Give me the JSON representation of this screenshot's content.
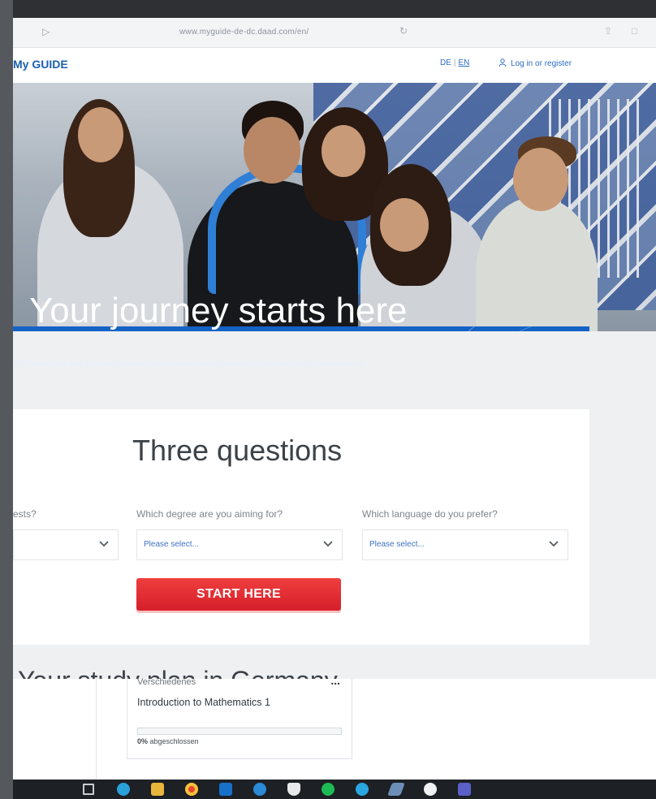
{
  "browser": {
    "url": "www.myguide-de-dc.daad.com/en/"
  },
  "header": {
    "logo": "My GUIDE",
    "lang_de": "DE",
    "lang_sep": "|",
    "lang_en": "EN",
    "login": "Log in or register"
  },
  "hero": {
    "title": "Your journey starts here",
    "subtitle": "IDE helps you find your way through the richness and diversity of German study programmes"
  },
  "questions": {
    "heading": "Three questions",
    "items": [
      {
        "label": "ests?",
        "value": ""
      },
      {
        "label": "Which degree are you aiming for?",
        "value": "Please select..."
      },
      {
        "label": "Which language do you prefer?",
        "value": "Please select..."
      }
    ],
    "start_label": "START HERE",
    "next_heading": "Your study plan in Germany"
  },
  "course": {
    "category": "Verschiedenes",
    "more": "...",
    "title": "Introduction to Mathematics 1",
    "progress_fraction": 0,
    "progress_pct": "0%",
    "progress_text": " abgeschlossen"
  },
  "taskbar": {
    "icons": [
      "task-view-icon",
      "edge-icon",
      "file-explorer-icon",
      "chrome-icon",
      "outlook-icon",
      "skype-icon",
      "security-icon",
      "spotify-icon",
      "telegram-icon",
      "pen-icon",
      "app-icon",
      "teams-icon"
    ]
  },
  "colors": {
    "brand_blue": "#1462c6",
    "link_blue": "#2c6cc2",
    "start_red": "#e1262f"
  }
}
